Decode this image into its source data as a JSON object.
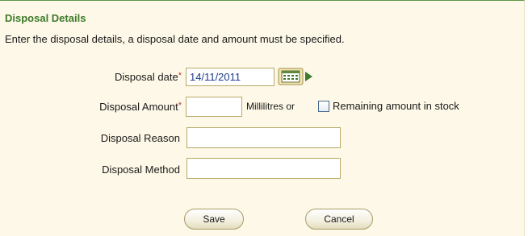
{
  "section": {
    "title": "Disposal Details",
    "instructions": "Enter the disposal details, a disposal date and amount must be specified."
  },
  "form": {
    "date": {
      "label": "Disposal date",
      "required_mark": "*",
      "value": "14/11/2011",
      "calendar_icon": "calendar-icon"
    },
    "amount": {
      "label": "Disposal Amount",
      "required_mark": "*",
      "value": "",
      "unit": "Millilitres or",
      "remaining_label": "Remaining amount in stock",
      "remaining_checked": false
    },
    "reason": {
      "label": "Disposal Reason",
      "value": ""
    },
    "method": {
      "label": "Disposal Method",
      "value": ""
    }
  },
  "buttons": {
    "save": "Save",
    "cancel": "Cancel"
  },
  "colors": {
    "title": "#3d7a2a",
    "panel_bg": "#fdf8e7",
    "required": "#c0392b",
    "field_text": "#1f3a8a"
  }
}
